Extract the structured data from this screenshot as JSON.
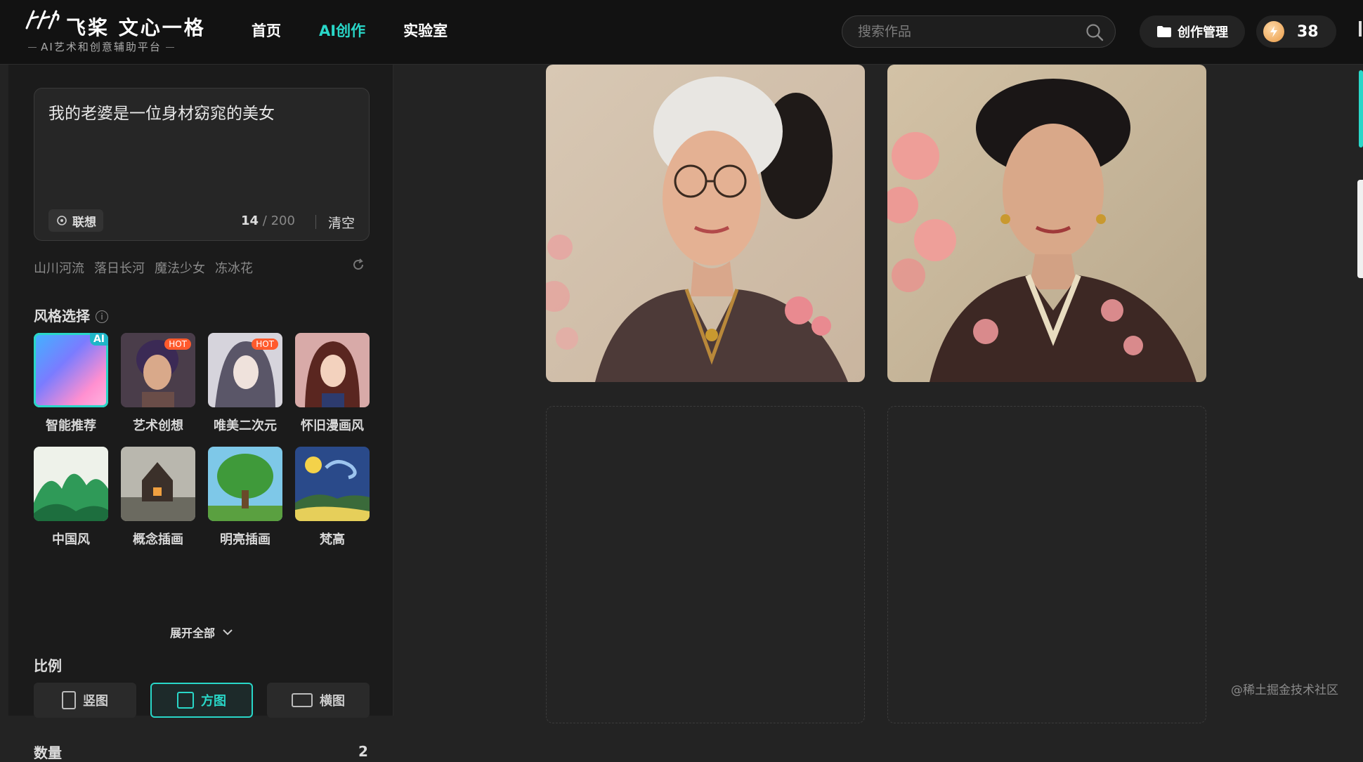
{
  "brand": {
    "name": "飞桨 文心一格",
    "subtitle": "AI艺术和创意辅助平台"
  },
  "nav": {
    "items": [
      {
        "label": "首页"
      },
      {
        "label": "AI创作"
      },
      {
        "label": "实验室"
      }
    ],
    "active": "AI创作"
  },
  "search": {
    "placeholder": "搜索作品",
    "value": ""
  },
  "header": {
    "manage_label": "创作管理",
    "points": "38"
  },
  "prompt": {
    "text": "我的老婆是一位身材窈窕的美女",
    "assoc_label": "联想",
    "count_current": "14",
    "count_max": "/ 200",
    "clear_label": "清空"
  },
  "suggestions": [
    "山川河流",
    "落日长河",
    "魔法少女",
    "冻冰花"
  ],
  "style_section": {
    "title": "风格选择",
    "info_icon": "i",
    "items": [
      {
        "label": "智能推荐",
        "badge": "AI"
      },
      {
        "label": "艺术创想",
        "badge": "HOT"
      },
      {
        "label": "唯美二次元",
        "badge": "HOT"
      },
      {
        "label": "怀旧漫画风",
        "badge": ""
      },
      {
        "label": "中国风",
        "badge": ""
      },
      {
        "label": "概念插画",
        "badge": ""
      },
      {
        "label": "明亮插画",
        "badge": ""
      },
      {
        "label": "梵高",
        "badge": ""
      }
    ],
    "selected": "智能推荐",
    "expand_label": "展开全部"
  },
  "ratio_section": {
    "title": "比例",
    "options": [
      {
        "label": "竖图"
      },
      {
        "label": "方图"
      },
      {
        "label": "横图"
      }
    ],
    "selected": "方图"
  },
  "quantity_section": {
    "title": "数量",
    "value": "2"
  },
  "results": {
    "images": [
      {
        "subject": "elderly woman portrait with glasses, white hair bun, dark embroidered robe"
      },
      {
        "subject": "middle-aged woman portrait, black hair bun, dark robe with pink flowers"
      }
    ],
    "empty_slots": 2
  },
  "watermark": "@稀土掘金技术社区",
  "colors": {
    "accent": "#29d7c8",
    "hot": "#ff5a2c",
    "background": "#232323",
    "panel": "#1b1b1b"
  }
}
